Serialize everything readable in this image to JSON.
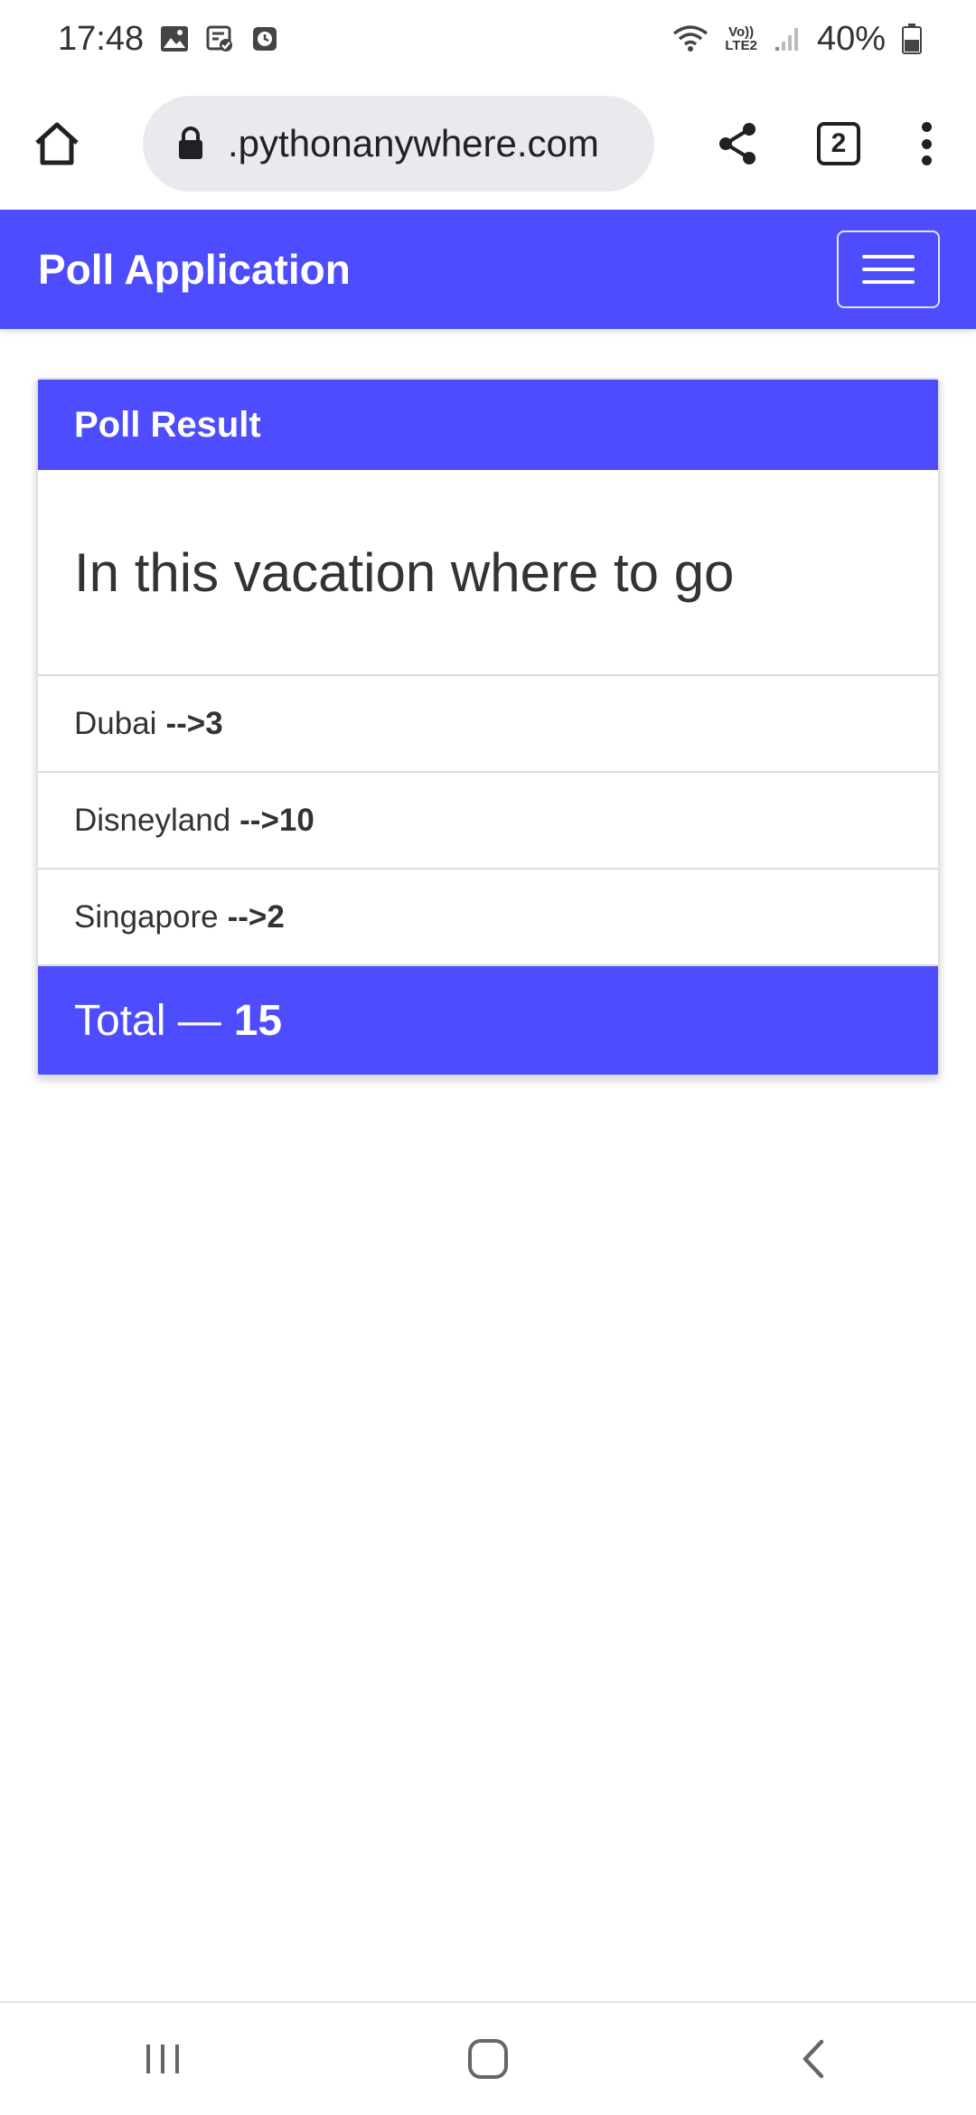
{
  "status_bar": {
    "time": "17:48",
    "network_label_top": "Vo))",
    "network_label_bottom": "LTE2",
    "battery": "40%"
  },
  "browser": {
    "url": ".pythonanywhere.com",
    "tab_count": "2"
  },
  "navbar": {
    "brand": "Poll Application"
  },
  "poll": {
    "header": "Poll Result",
    "question": "In this vacation where to go",
    "choices": [
      {
        "name": "Dubai",
        "count": "-->3"
      },
      {
        "name": "Disneyland",
        "count": "-->10"
      },
      {
        "name": "Singapore",
        "count": "-->2"
      }
    ],
    "total_label": "Total —",
    "total_value": "15"
  },
  "colors": {
    "accent": "#4d4dff",
    "text": "#333333"
  }
}
